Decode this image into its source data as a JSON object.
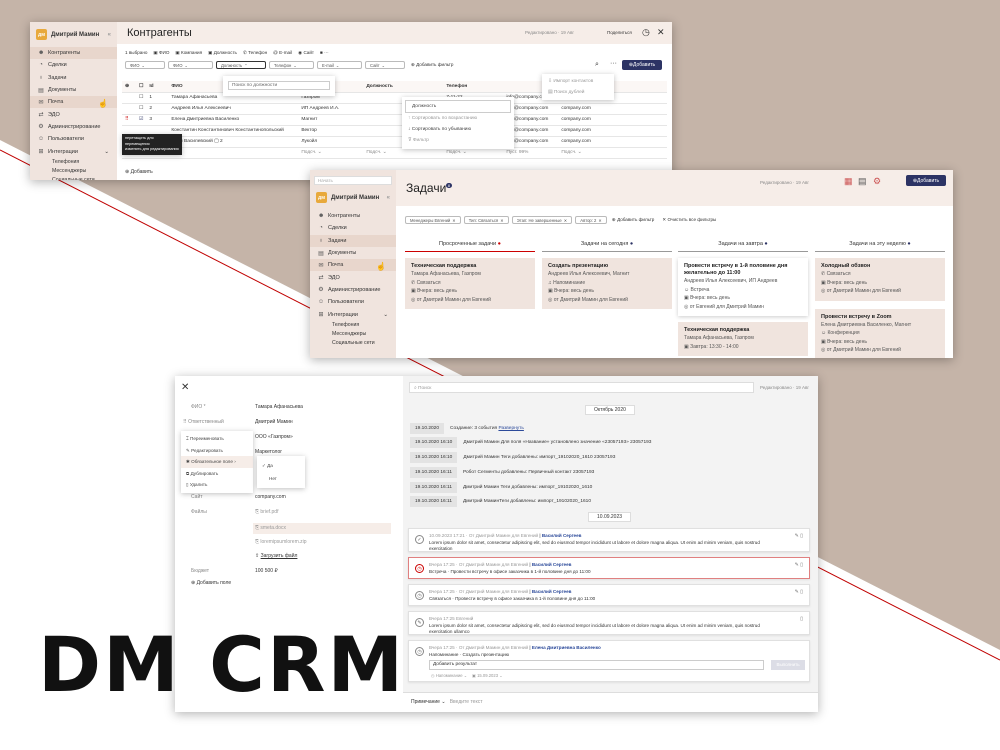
{
  "brand": "DM CRM",
  "colors": {
    "primary": "#2c3364",
    "bg": "#c5b4a8",
    "sidebar": "#f0e4de",
    "accent_red": "#c00000"
  },
  "nav": [
    "Контрагенты",
    "Сделки",
    "Задачи",
    "Документы",
    "Почта",
    "ЭДО",
    "Администрирование",
    "Пользователи",
    "Интеграции"
  ],
  "nav_sub": [
    "Телефония",
    "Мессенджеры",
    "Социальные сети"
  ],
  "user": "Дмитрий Мамин",
  "user_initials": "ДМ",
  "w1": {
    "title": "Контрагенты",
    "edited": "Редактировано · 19 Авг",
    "share": "Поделиться",
    "selected": "1 выбрано",
    "toolbar": [
      "ФИО",
      "Компания",
      "Должность",
      "Телефон",
      "E-mail",
      "Сайт"
    ],
    "filters": [
      "ФИО",
      "ФИО",
      "Должность",
      "Телефон",
      "E-mail",
      "Сайт"
    ],
    "add_filter": "Добавить фильтр",
    "add_btn": "Добавить",
    "search_placeholder": "Поиск по должности",
    "import": "Импорт контактов",
    "dup": "Поиск дублей",
    "headers": [
      "Id",
      "ФИО",
      "Компания",
      "Должность",
      "Телефон"
    ],
    "rows": [
      {
        "id": "1",
        "fio": "Тамара Афанасьева",
        "company": "Газпром",
        "phone": "7-11-22",
        "email": "info@company.com",
        "site": "company.com"
      },
      {
        "id": "2",
        "fio": "Андреев Илья Алексеевич",
        "company": "ИП Андреев И.А.",
        "phone": "7-11-22",
        "email": "info@company.com",
        "site": "company.com"
      },
      {
        "id": "3",
        "fio": "Елена Дмитриевна Василенко",
        "company": "Магнит",
        "phone": "7-11-22",
        "email": "info@company.com",
        "site": "company.com"
      },
      {
        "id": "",
        "fio": "Константин Константинович Константинопольский",
        "company": "Вектор",
        "phone": "7-11-22",
        "email": "info@company.com",
        "site": "company.com"
      },
      {
        "id": "",
        "fio": "Илья Василевский",
        "company": "Лукойл",
        "phone": "7-11-22",
        "email": "info@company.com",
        "site": "company.com"
      }
    ],
    "sum": "Подсч.",
    "empty": "Пуст. 99%",
    "add_row": "Добавить",
    "tooltip1": "перетащить для перемещения",
    "tooltip2": "изменить для редактирования",
    "sort_menu": [
      "Должность",
      "Сортировать по возрастанию",
      "Сортировать по убыванию",
      "Фильтр"
    ]
  },
  "w2": {
    "title": "Задачи",
    "badge": "8",
    "edited": "Редактировано · 19 Авг",
    "search_placeholder": "Начать",
    "chips": [
      "Менеджеры Евгений",
      "Тип: Связаться",
      "Этап: Не завершенные",
      "Автор: 2"
    ],
    "add_filter": "Добавить фильтр",
    "clear": "Очистить все фильтры",
    "add_btn": "Добавить",
    "cols": [
      "Просроченные задачи",
      "Задачи на сегодня",
      "Задачи на завтра",
      "Задачи на эту неделю"
    ],
    "cards": [
      {
        "title": "Техническая поддержка",
        "who": "Тамара Афанасьева, Газпром",
        "type": "Связаться",
        "when": "Вчера: весь день",
        "from": "от Дмитрий Мамин для Евгений"
      },
      {
        "title": "Создать презентацию",
        "who": "Андреев Илья Алексеевич, Магнит",
        "type": "Напоминание",
        "when": "Вчера: весь день",
        "from": "от Дмитрий Мамин для Евгений"
      },
      {
        "title": "Провести встречу в 1-й половине дня желательно до 11:00",
        "who": "Андреев Илья Алексеевич, ИП Андреев",
        "type": "Встреча",
        "when": "Вчера: весь день",
        "from": "от Евгений для Дмитрий Мамин"
      },
      {
        "title": "Холодный обзвон",
        "who": "",
        "type": "Связаться",
        "when": "Вчера: весь день",
        "from": "от Дмитрий Мамин для Евгений"
      },
      {
        "title": "Техническая поддержка",
        "who": "Тамара Афанасьева, Газпром",
        "type": "",
        "when": "Завтра: 13:30 - 14:00",
        "from": "от Дмитрий Мамин для Евгений"
      },
      {
        "title": "Провести встречу в Zoom",
        "who": "Елена Дмитриевна Василенко, Магнит",
        "type": "Конференция",
        "when": "Вчера: весь день",
        "from": "от Дмитрий Мамин для Евгений"
      }
    ]
  },
  "w3": {
    "fields": [
      {
        "label": "ФИО *",
        "value": "Тамара Афанасьева"
      },
      {
        "label": "Ответственный",
        "value": "Дмитрий Мамин"
      },
      {
        "label": "",
        "value": "ООО «Газпром»"
      },
      {
        "label": "",
        "value": "Маркетолог"
      },
      {
        "label": "Сайт",
        "value": "company.com"
      },
      {
        "label": "Файлы",
        "value": "brief.pdf"
      },
      {
        "label": "",
        "value": "smeta.docx"
      },
      {
        "label": "",
        "value": "loremipsumlorem.zip"
      }
    ],
    "upload": "Загрузить файл",
    "budget_label": "Бюджет",
    "budget": "100 500 ₽",
    "add_field": "Добавить поле",
    "ctx": [
      "Переименовать",
      "Редактировать",
      "Обязательное поле",
      "Дублировать",
      "Удалить"
    ],
    "ctx_sub": [
      "Да",
      "Нет"
    ],
    "search_placeholder": "Поиск",
    "edited": "Редактировано · 19 Авг",
    "date1": "Октябрь 2020",
    "logs": [
      {
        "d": "19.10.2020",
        "t": "Создание: 3 события",
        "link": "Развернуть"
      },
      {
        "d": "19.10.2020 16:10",
        "t": "Дмитрий Мамин Для поля «Название» установлено значение «23057193» 23057193",
        "link": ""
      },
      {
        "d": "19.10.2020 16:10",
        "t": "Дмитрий Мамин Теги добавлены: импорт_19102020_1610 23057193",
        "link": ""
      },
      {
        "d": "19.10.2020 16:11",
        "t": "Робот Сегменты добавлены: Первичный контакт 23057193",
        "link": ""
      },
      {
        "d": "19.10.2020 16:11",
        "t": "Дмитрий Мамин Теги добавлены: импорт_19102020_1610",
        "link": ""
      },
      {
        "d": "19.10.2020 16:11",
        "t": "Дмитрий МаминТеги добавлены: импорт_19102020_1610",
        "link": ""
      }
    ],
    "date2": "10.09.2023",
    "tasks": [
      {
        "head": "10.09.2023 17:21 · От Дмитрий Мамин для Евгений",
        "who": "Василий Сергеев",
        "body": "Lorem ipsum dolor sit amet, consectetur adipiscing elit, sed do eiusmod tempor incididunt ut labore et dolore magna aliqua. Ut enim ad minim veniam, quis nostrud exercitation"
      },
      {
        "head": "Вчера 17:25 · От Дмитрий Мамин для Евгений",
        "who": "Василий Сергеев",
        "body": "Встреча · Провести встречу в офисе заказчика в 1-й половине дня до 11:00"
      },
      {
        "head": "Вчера 17:25 · От Дмитрий Мамин для Евгений",
        "who": "Василий Сергеев",
        "body": "Связаться · Провести встречу в офисе заказчика в 1-й половине дня до 11:00"
      },
      {
        "head": "Вчера 17:25 Евгений",
        "who": "",
        "body": "Lorem ipsum dolor sit amet, consectetur adipiscing elit, sed do eiusmod tempor incididunt ut labore et dolore magna aliqua. Ut enim ad minim veniam, quis nostrud exercitation ullamco"
      },
      {
        "head": "Вчера 17:25 · От Дмитрий Мамин для Евгений",
        "who": "Елена Дмитриевна Василенко",
        "body": "Напоминание · Создать презентацию"
      }
    ],
    "result_placeholder": "Добавить результат",
    "result_btn": "Выполнить",
    "result_meta1": "Напоминание",
    "result_meta2": "15.09.2023",
    "note_label": "Примечание",
    "note_placeholder": "Введите текст"
  }
}
